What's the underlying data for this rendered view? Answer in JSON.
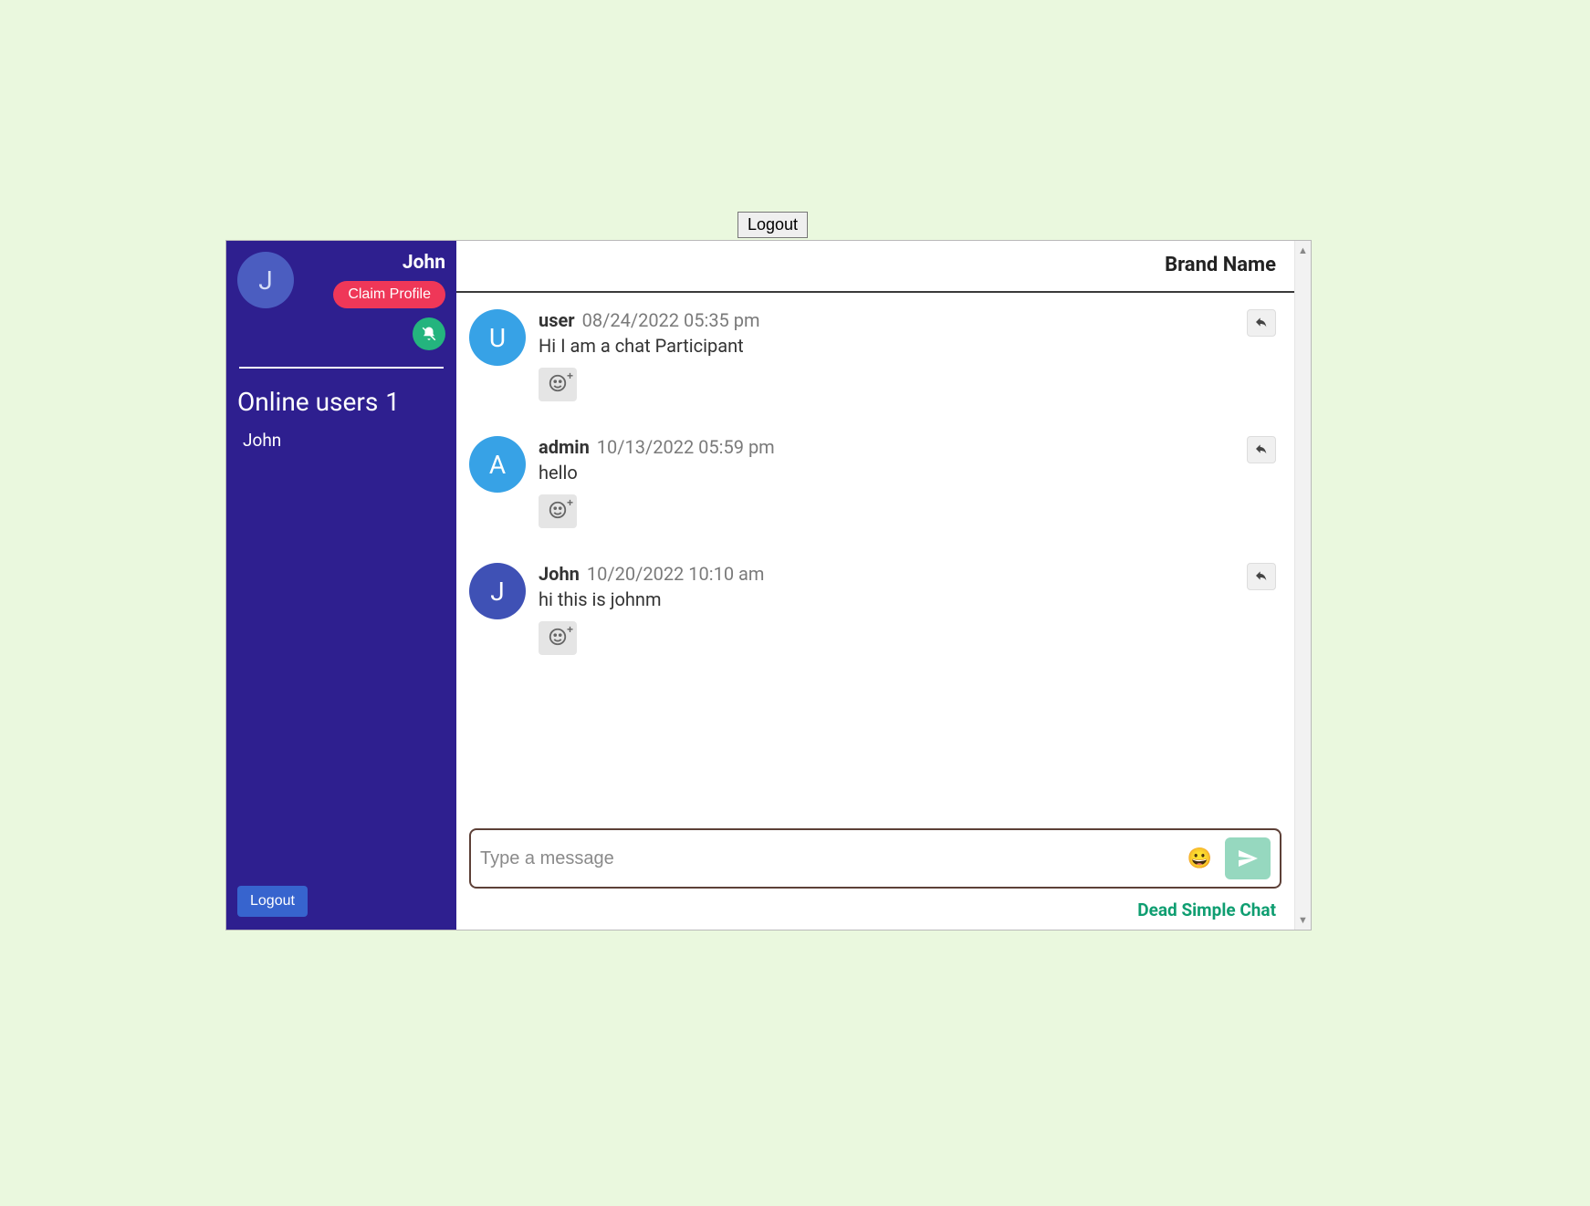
{
  "top_logout": "Logout",
  "sidebar": {
    "profile": {
      "initial": "J",
      "name": "John",
      "claim_label": "Claim Profile"
    },
    "online": {
      "title": "Online users",
      "count": "1"
    },
    "users": [
      {
        "name": "John"
      }
    ],
    "logout_label": "Logout"
  },
  "header": {
    "brand": "Brand Name"
  },
  "messages": [
    {
      "avatar_initial": "U",
      "avatar_bg": "#37a2e6",
      "author": "user",
      "timestamp": "08/24/2022 05:35 pm",
      "text": "Hi I am a chat Participant"
    },
    {
      "avatar_initial": "A",
      "avatar_bg": "#37a2e6",
      "author": "admin",
      "timestamp": "10/13/2022 05:59 pm",
      "text": "hello"
    },
    {
      "avatar_initial": "J",
      "avatar_bg": "#3f51b5",
      "author": "John",
      "timestamp": "10/20/2022 10:10 am",
      "text": "hi this is johnm"
    }
  ],
  "composer": {
    "placeholder": "Type a message"
  },
  "footer": {
    "link_text": "Dead Simple Chat"
  }
}
